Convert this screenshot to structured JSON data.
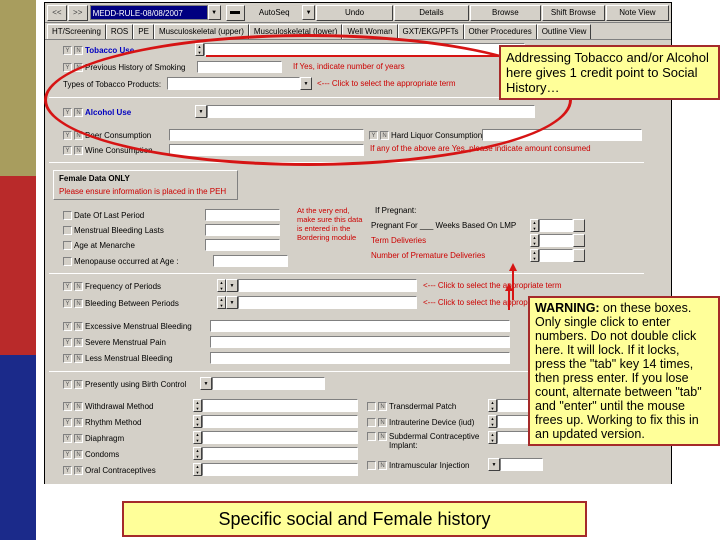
{
  "toolbar": {
    "nav_prev": "<<",
    "nav_next": ">>",
    "record_value": "MEDD-RULE-08/08/2007",
    "combo_arrow": "▼",
    "autoseq_label": "AutoSeq",
    "autoseq_arrow": "▼",
    "buttons": [
      {
        "label": "Undo"
      },
      {
        "label": "Details"
      },
      {
        "label": "Browse"
      },
      {
        "label": "Shift Browse"
      },
      {
        "label": "Note View"
      }
    ]
  },
  "tabs": [
    {
      "label": "HT/Screening",
      "active": true
    },
    {
      "label": "ROS",
      "active": false
    },
    {
      "label": "PE",
      "active": false
    },
    {
      "label": "Musculoskeletal (upper)",
      "active": false
    },
    {
      "label": "Musculoskeletal (lower)",
      "active": false
    },
    {
      "label": "Well Woman",
      "active": false
    },
    {
      "label": "GXT/EKG/PFTs",
      "active": false
    },
    {
      "label": "Other Procedures",
      "active": false
    },
    {
      "label": "Outline View",
      "active": false
    }
  ],
  "yn": {
    "yes": "Y",
    "no": "N"
  },
  "social": {
    "tobacco_use": "Tobacco Use",
    "previous_smoking": "Previous History of Smoking",
    "previous_smoking_hint": "If Yes, indicate number of years",
    "types_tobacco": "Types of Tobacco Products:",
    "types_tobacco_hint": "<--- Click to select the appropriate term",
    "alcohol_use": "Alcohol Use",
    "beer": "Beer Consumption",
    "wine": "Wine Consumption",
    "hard_liquor": "Hard Liquor Consumption",
    "amount_hint": "If any of the above are Yes, please indicate amount consumed"
  },
  "female": {
    "section_title": "Female Data ONLY",
    "section_note": "Please ensure information is placed in the PEH",
    "date_last_period": "Date Of Last Period",
    "menstrual_bleeding_lasts": "Menstrual Bleeding Lasts",
    "age_menarche": "Age at Menarche",
    "menopause_age": "Menopause occurred at Age :",
    "side_note": "At the very end, make sure this data is entered in the Bordering module",
    "if_pregnant": "If Pregnant:",
    "pregnant_weeks": "Pregnant For ___ Weeks Based On LMP",
    "term_deliveries": "Term Deliveries",
    "premature_deliveries": "Number of Premature Deliveries",
    "frequency_periods": "Frequency of Periods",
    "bleeding_between": "Bleeding Between Periods",
    "click_hint": "<--- Click to select the appropriate term",
    "excessive_bleeding": "Excessive Menstrual Bleeding",
    "severe_pain": "Severe Menstrual Pain",
    "less_bleeding": "Less Menstrual Bleeding"
  },
  "contraception": {
    "presently_using": "Presently using Birth Control",
    "withdrawal": "Withdrawal Method",
    "rhythm": "Rhythm Method",
    "diaphragm": "Diaphragm",
    "condoms": "Condoms",
    "oral": "Oral Contraceptives",
    "patch": "Transdermal Patch",
    "iud": "Intrauterine Device (iud)",
    "implant": "Subdermal Contraceptive Implant:",
    "injection": "Intramuscular Injection"
  },
  "callouts": {
    "tobacco": "Addressing Tobacco and/or Alcohol here gives 1 credit point to Social History…",
    "warning_bold": "WARNING:",
    "warning_text": " on these boxes. Only single click to enter numbers.  Do not double click here.  It will lock.  If it locks, press the \"tab\" key 14 times, then press enter.  If you lose count, alternate between \"tab\" and \"enter\" until the mouse frees up. Working to fix this in an updated version.",
    "caption": "Specific social and Female history"
  },
  "colors": {
    "band_olive": "#a89d5e",
    "band_red": "#b92a2a",
    "band_navy": "#1b2a8a",
    "callout_bg": "#ffff99",
    "callout_border": "#a52a2a",
    "highlight_red": "#d61414",
    "window_gray": "#d4d0c8"
  }
}
